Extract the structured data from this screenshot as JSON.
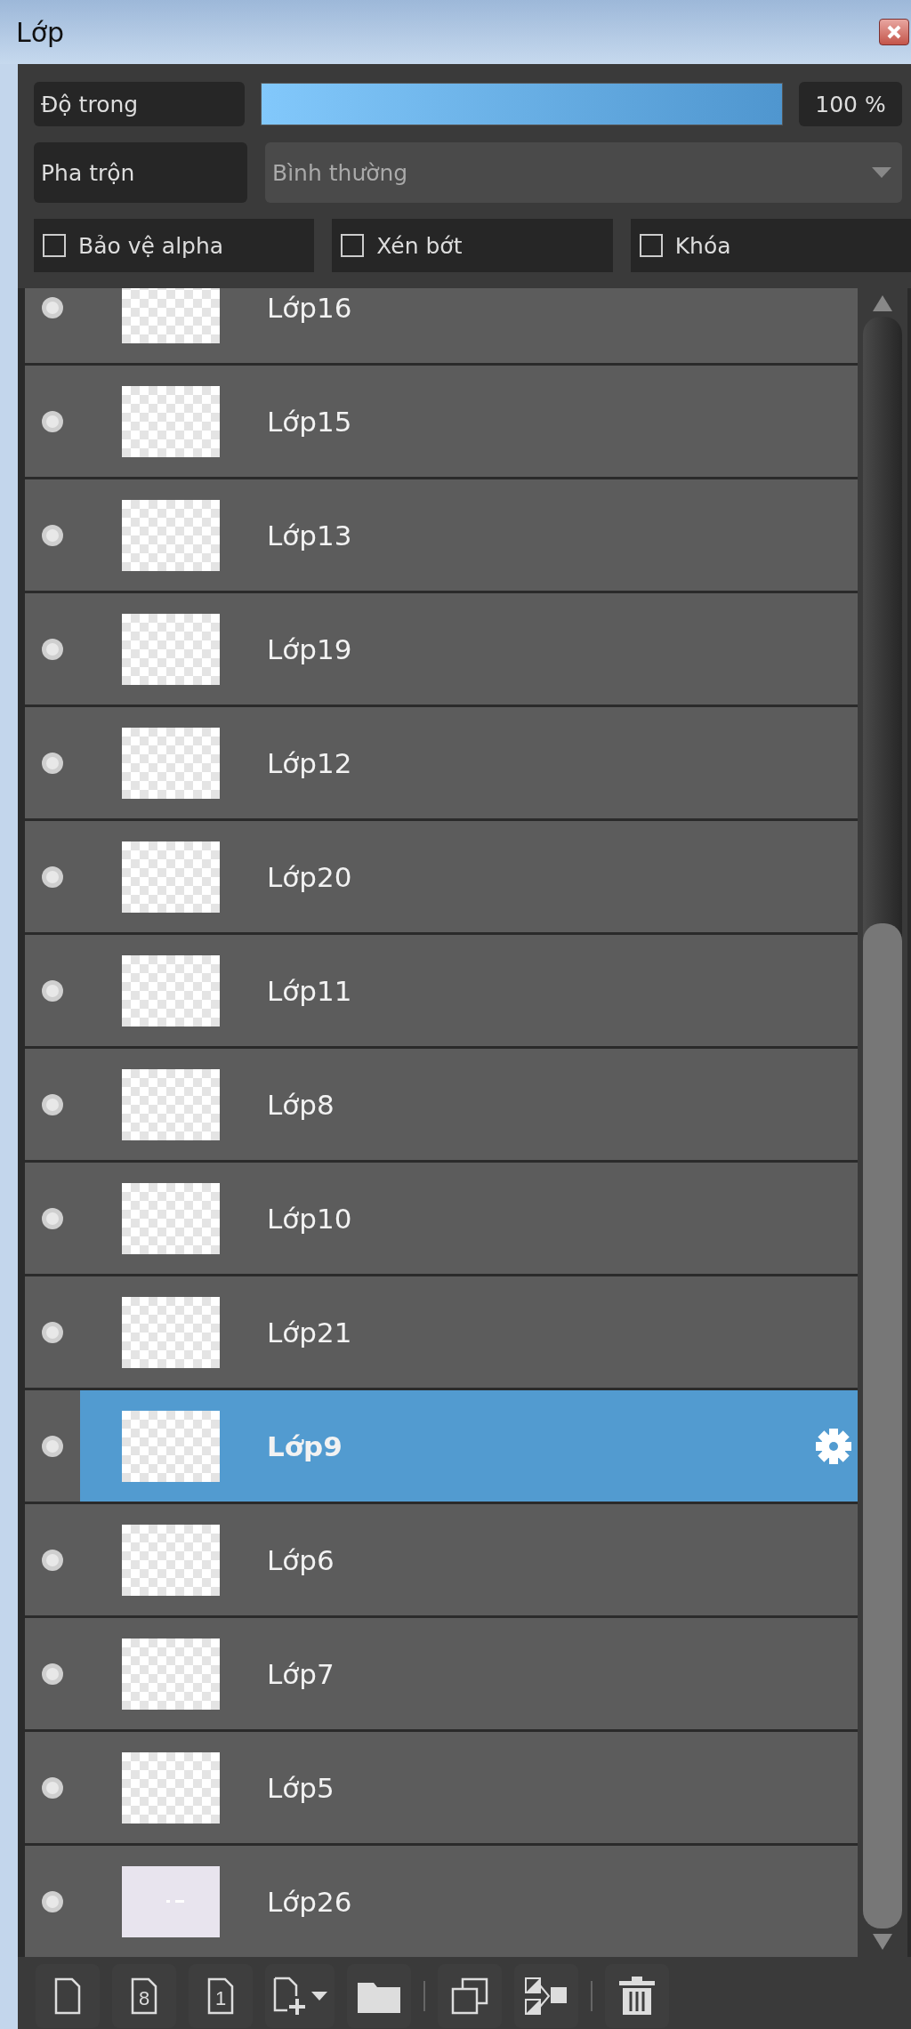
{
  "window": {
    "title": "Lớp"
  },
  "opacity": {
    "label": "Độ trong",
    "level": 1.0,
    "reading": "100 %"
  },
  "blend": {
    "label": "Pha trộn",
    "value": "Bình thường"
  },
  "options": [
    {
      "label": "Bảo vệ alpha",
      "checked": false
    },
    {
      "label": "Xén bớt",
      "checked": false
    },
    {
      "label": "Khóa",
      "checked": false
    }
  ],
  "layers": [
    {
      "name": "Lớp16",
      "selected": false,
      "kind": "transparent"
    },
    {
      "name": "Lớp15",
      "selected": false,
      "kind": "transparent"
    },
    {
      "name": "Lớp13",
      "selected": false,
      "kind": "transparent"
    },
    {
      "name": "Lớp19",
      "selected": false,
      "kind": "transparent"
    },
    {
      "name": "Lớp12",
      "selected": false,
      "kind": "transparent"
    },
    {
      "name": "Lớp20",
      "selected": false,
      "kind": "transparent"
    },
    {
      "name": "Lớp11",
      "selected": false,
      "kind": "transparent"
    },
    {
      "name": "Lớp8",
      "selected": false,
      "kind": "transparent"
    },
    {
      "name": "Lớp10",
      "selected": false,
      "kind": "transparent"
    },
    {
      "name": "Lớp21",
      "selected": false,
      "kind": "transparent"
    },
    {
      "name": "Lớp9",
      "selected": true,
      "kind": "transparent"
    },
    {
      "name": "Lớp6",
      "selected": false,
      "kind": "transparent"
    },
    {
      "name": "Lớp7",
      "selected": false,
      "kind": "transparent"
    },
    {
      "name": "Lớp5",
      "selected": false,
      "kind": "transparent"
    },
    {
      "name": "Lớp26",
      "selected": false,
      "kind": "filled"
    }
  ],
  "toolbar": [
    {
      "kind": "new"
    },
    {
      "kind": "numbered",
      "label": "8"
    },
    {
      "kind": "numbered",
      "label": "1"
    },
    {
      "kind": "add-menu"
    },
    {
      "kind": "folder"
    },
    {
      "kind": "separator"
    },
    {
      "kind": "duplicate"
    },
    {
      "kind": "merge"
    },
    {
      "kind": "separator"
    },
    {
      "kind": "delete"
    }
  ]
}
